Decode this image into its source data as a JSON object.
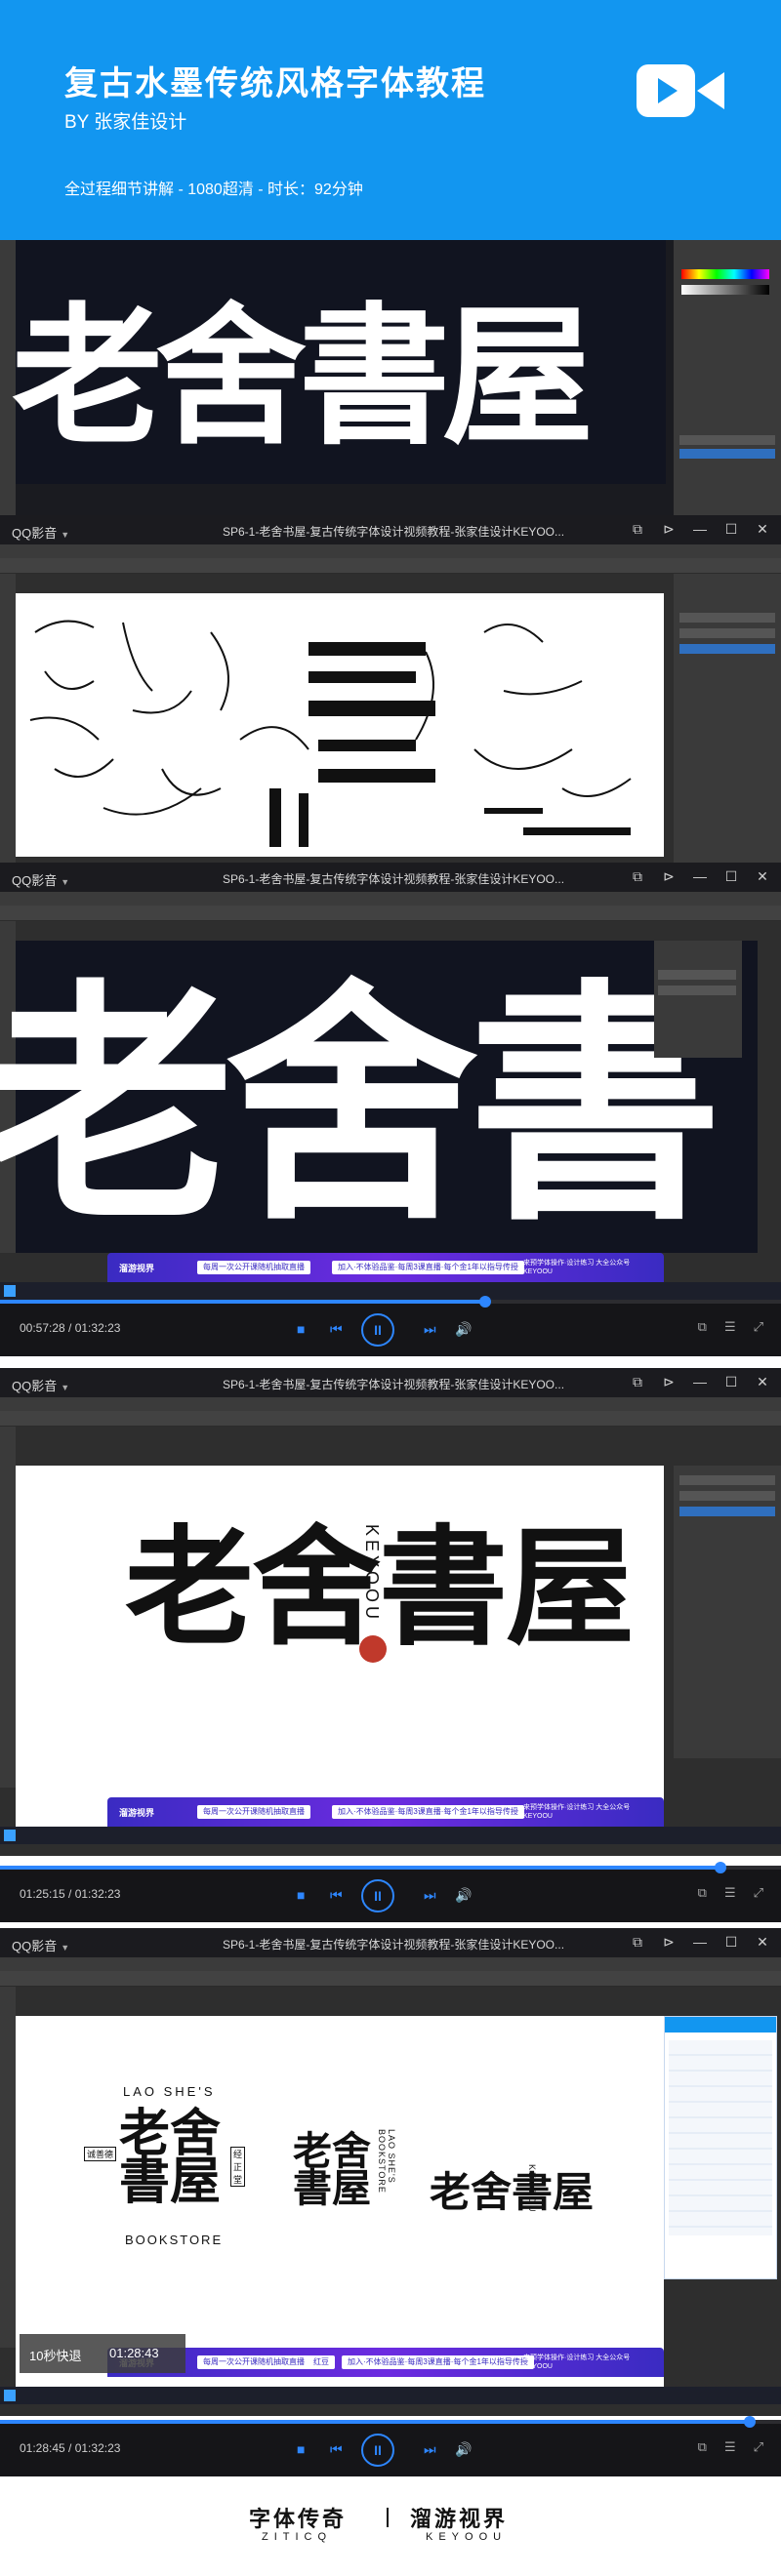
{
  "header": {
    "title": "复古水墨传统风格字体教程",
    "author": "BY 张家佳设计",
    "meta": "全过程细节讲解 - 1080超清 - 时长：92分钟",
    "logo_icon": "video-camera-icon"
  },
  "player": {
    "app_name": "QQ影音",
    "video_title": "SP6-1-老舍书屋-复古传统字体设计视频教程-张家佳设计KEYOO..."
  },
  "frames": [
    {
      "artwork": "老舍書屋"
    },
    {
      "artwork": ""
    },
    {
      "artwork": "老舍書",
      "time": "00:57:28 / 01:32:23",
      "progress": 0.622
    },
    {
      "artwork": "老舍書屋",
      "side_text": "KEYOOU",
      "time": "01:25:15 / 01:32:23",
      "progress": 0.923
    },
    {
      "time": "01:28:45 / 01:32:23",
      "progress": 0.961,
      "speed_tip": "10秒快退",
      "speed_time": "01:28:43",
      "logo_top": "LAO SHE'S",
      "logo_main": "老舍書屋",
      "logo_bottom": "BOOKSTORE",
      "logo_left_tag": "诚善德",
      "logo_right_tag": "经正堂",
      "vertical_art": "老舍書屋",
      "vertical_side": "LAO SHE'S BOOKSTORE",
      "horizontal_art": "老舍書屋",
      "horizontal_side": "KEYOOU"
    }
  ],
  "banner": {
    "logo": "溜游视界",
    "pill1": "每周一次公开课随机抽取直播",
    "pill2": "加入·不体验品鉴·每周3课直播·每个金1年以指导传授",
    "pill3": "红豆",
    "right_text": "来预学体操作·设计练习 大全公众号 KEYOOU"
  },
  "footer": {
    "brand1": "字体传奇",
    "brand1_sub": "ZITICQ",
    "brand2": "溜游视界",
    "brand2_sub": "KEYOOU"
  }
}
